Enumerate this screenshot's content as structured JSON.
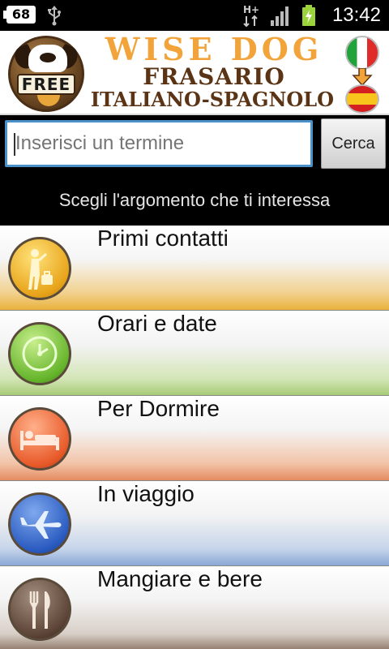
{
  "status_bar": {
    "battery_level": "68",
    "time": "13:42",
    "icons": [
      "usb-icon",
      "network-h-plus-icon",
      "signal-icon",
      "battery-charging-icon"
    ]
  },
  "header": {
    "logo_badge": "FREE",
    "title_line1": "WISE DOG",
    "title_line2": "FRASARIO",
    "title_line3": "ITALIANO-SPAGNOLO",
    "flags": [
      "italy-flag-icon",
      "spain-flag-icon"
    ]
  },
  "search": {
    "placeholder": "Inserisci un termine",
    "value": "",
    "button_label": "Cerca"
  },
  "prompt": "Scegli l'argomento che ti interessa",
  "topics": [
    {
      "label": "Primi contatti",
      "icon": "traveler-icon",
      "color": "#e8a41a"
    },
    {
      "label": "Orari e date",
      "icon": "clock-icon",
      "color": "#66b52c"
    },
    {
      "label": "Per Dormire",
      "icon": "bed-icon",
      "color": "#e85a2a"
    },
    {
      "label": "In viaggio",
      "icon": "airplane-icon",
      "color": "#2a5bc0"
    },
    {
      "label": "Mangiare e bere",
      "icon": "fork-knife-icon",
      "color": "#5c4436"
    }
  ]
}
